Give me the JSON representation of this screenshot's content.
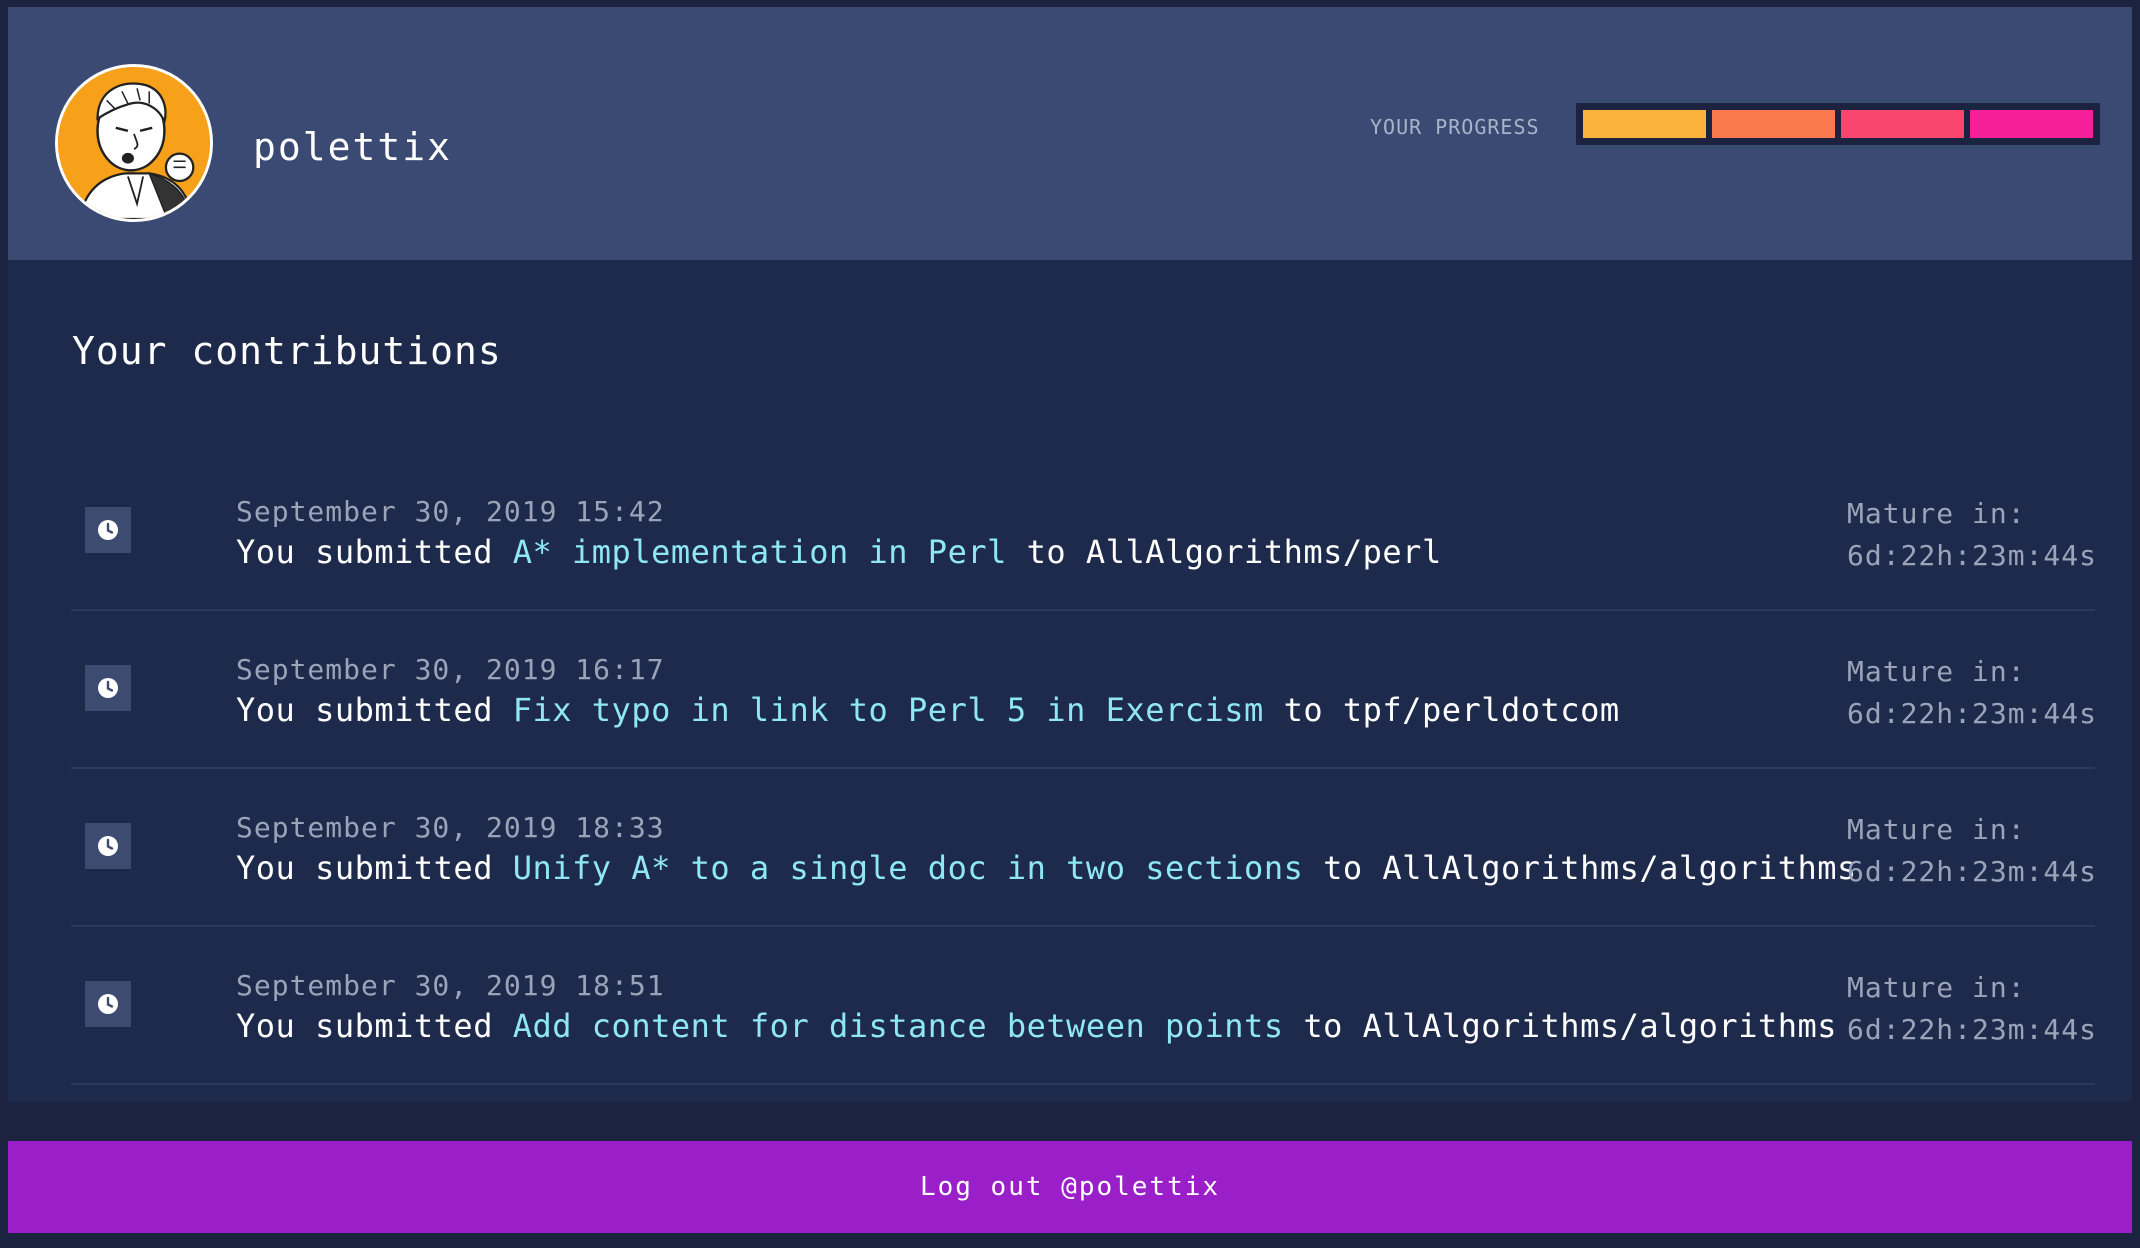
{
  "user": {
    "username": "polettix",
    "avatar_icon": "cartoon-avatar"
  },
  "progress": {
    "label": "YOUR PROGRESS",
    "segments_total": 4,
    "segments_filled": 4,
    "segment_colors": [
      "#fcb33c",
      "#fb7a4d",
      "#f8466e",
      "#f61f9a"
    ]
  },
  "contributions": {
    "title": "Your contributions",
    "items": [
      {
        "date": "September 30, 2019 15:42",
        "prefix": "You submitted",
        "pr_title": "A* implementation in Perl",
        "to_word": "to",
        "repo": "AllAlgorithms/perl",
        "mature_label": "Mature in:",
        "mature_value": "6d:22h:23m:44s",
        "icon": "clock-icon"
      },
      {
        "date": "September 30, 2019 16:17",
        "prefix": "You submitted",
        "pr_title": "Fix typo in link to Perl 5 in Exercism",
        "to_word": "to",
        "repo": "tpf/perldotcom",
        "mature_label": "Mature in:",
        "mature_value": "6d:22h:23m:44s",
        "icon": "clock-icon"
      },
      {
        "date": "September 30, 2019 18:33",
        "prefix": "You submitted",
        "pr_title": "Unify A* to a single doc in two sections",
        "to_word": "to",
        "repo": "AllAlgorithms/algorithms",
        "mature_label": "Mature in:",
        "mature_value": "6d:22h:23m:44s",
        "icon": "clock-icon"
      },
      {
        "date": "September 30, 2019 18:51",
        "prefix": "You submitted",
        "pr_title": "Add content for distance between points",
        "to_word": "to",
        "repo": "AllAlgorithms/algorithms",
        "mature_label": "Mature in:",
        "mature_value": "6d:22h:23m:44s",
        "icon": "clock-icon"
      }
    ]
  },
  "footer": {
    "logout_label": "Log out @polettix"
  },
  "colors": {
    "background": "#1e2a4c",
    "header": "#3a4a72",
    "accent_link": "#8fe6f4",
    "logout_bg": "#9b1fc8",
    "avatar_bg": "#f7a11a"
  }
}
